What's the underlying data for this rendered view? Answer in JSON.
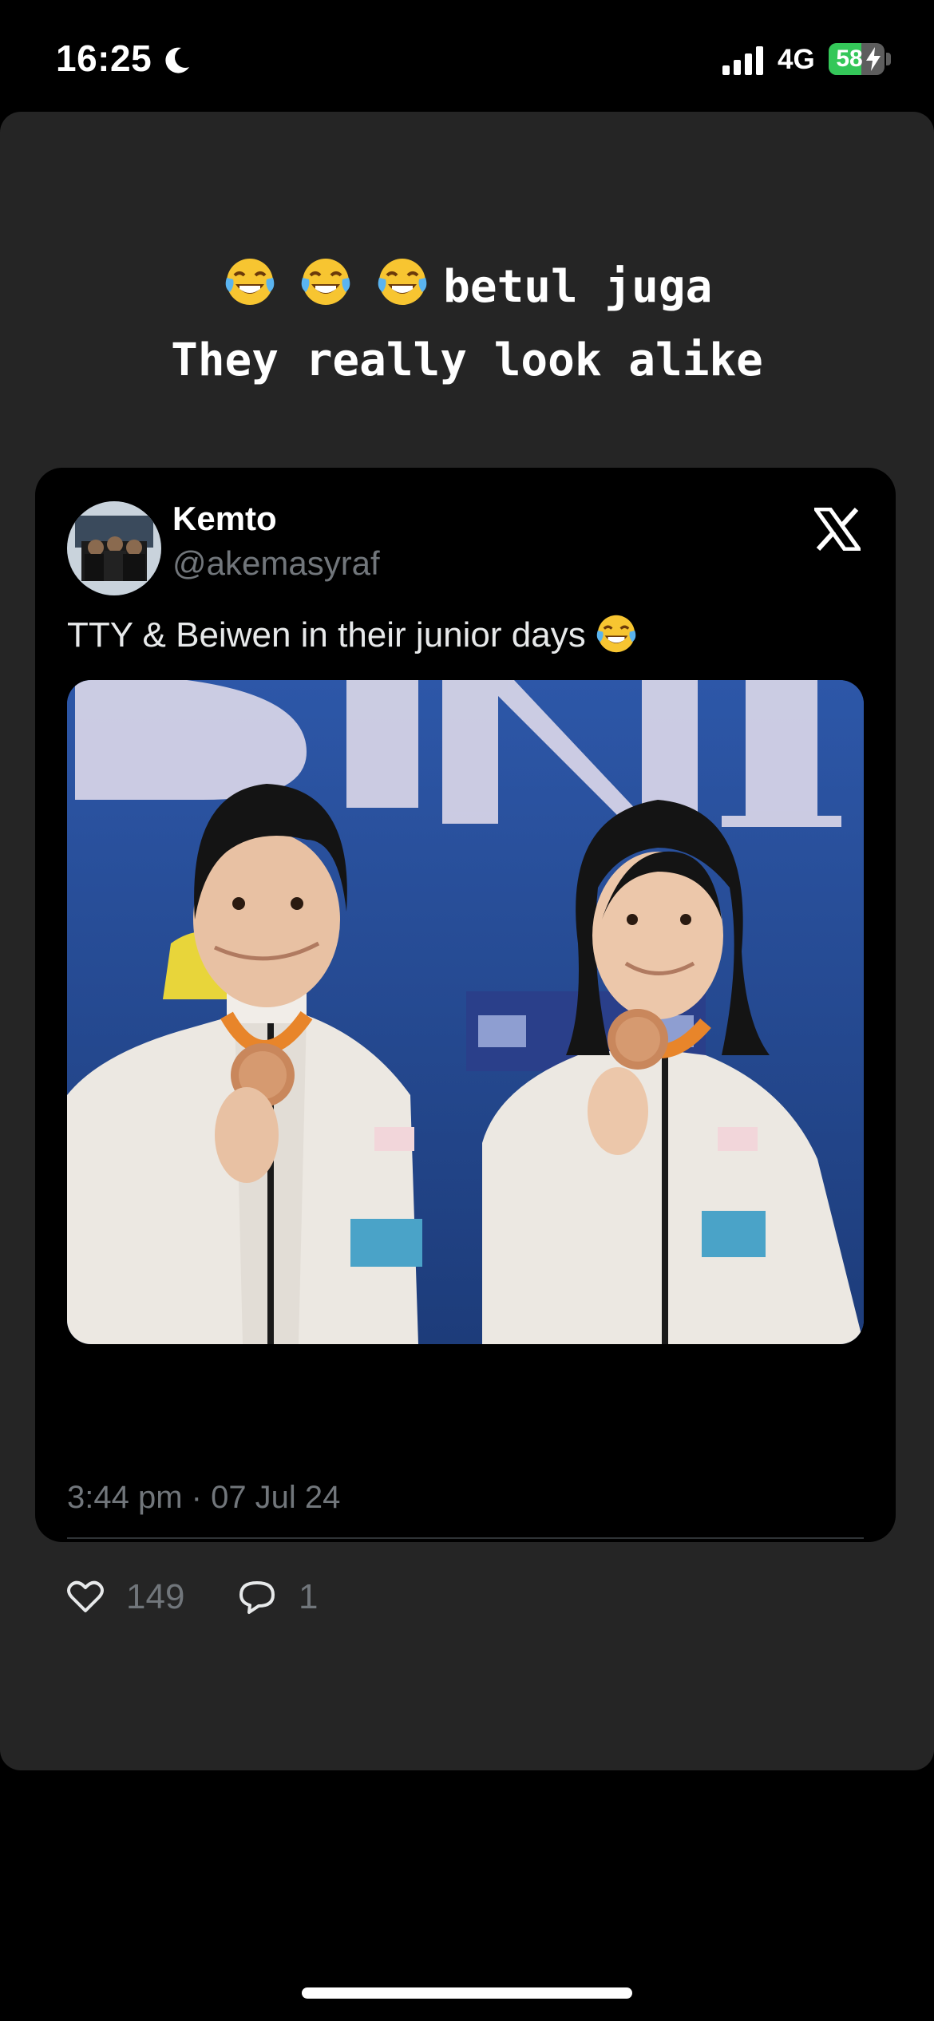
{
  "status_bar": {
    "time": "16:25",
    "network": "4G",
    "battery_percent": "58",
    "battery_level": 0.58
  },
  "story": {
    "caption_line1": "betul juga",
    "caption_line2": "They really look alike",
    "caption_emoji": "face-with-tears-of-joy-icon"
  },
  "tweet": {
    "author_name": "Kemto",
    "author_handle": "@akemasyraf",
    "text": "TTY & Beiwen in their junior days",
    "timestamp": "3:44 pm · 07 Jul 24",
    "likes": "149",
    "replies": "1"
  },
  "colors": {
    "story_bg": "#252525",
    "card_bg": "#000000",
    "muted_text": "#71767b",
    "battery_green": "#34c759"
  }
}
